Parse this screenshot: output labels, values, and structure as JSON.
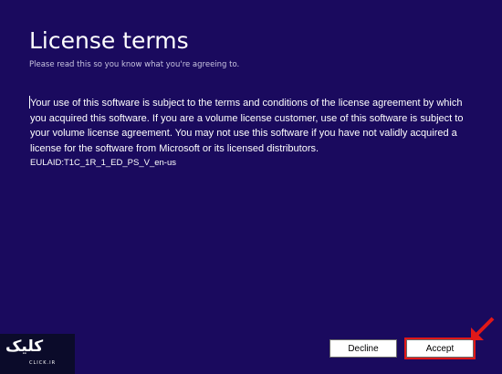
{
  "page": {
    "title": "License terms",
    "subtitle": "Please read this so you know what you're agreeing to."
  },
  "license": {
    "text": "Your use of this software is subject to the terms and conditions of the license agreement by which you acquired this software.  If you are a volume license customer, use of this software is subject to your volume license agreement.  You may not use this software if you have not validly acquired a license for the software from Microsoft or its licensed distributors.",
    "eula_id": "EULAID:T1C_1R_1_ED_PS_V_en-us"
  },
  "buttons": {
    "decline_label": "Decline",
    "accept_label": "Accept"
  },
  "watermark": {
    "logo_text": "کلیک",
    "logo_sub": "CLICK.IR"
  },
  "colors": {
    "background": "#1a0a5e",
    "highlight": "#e11818"
  },
  "icons": {
    "annotation": "red-arrow-icon",
    "watermark": "click-logo-icon"
  }
}
